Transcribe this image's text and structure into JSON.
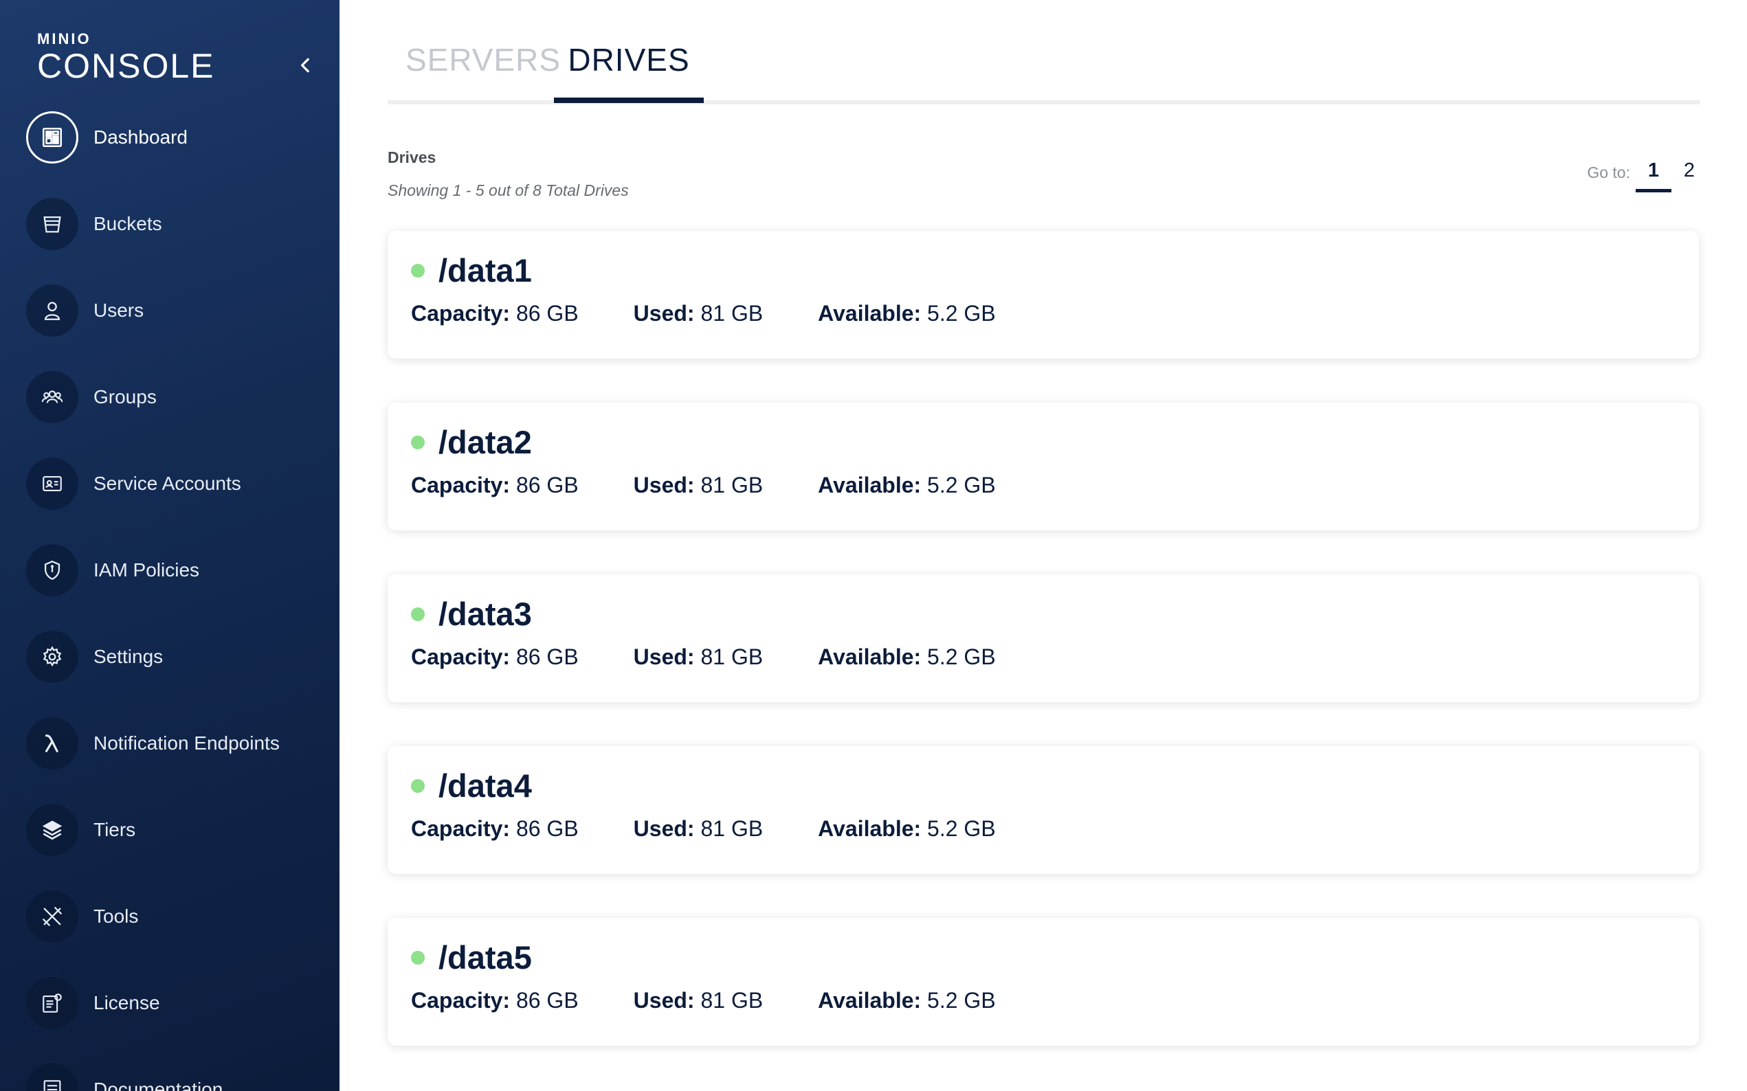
{
  "app": {
    "logo_top": "MINIO",
    "logo_main": "CONSOLE"
  },
  "sidebar": {
    "items": [
      {
        "label": "Dashboard",
        "icon": "dashboard-icon",
        "active": true
      },
      {
        "label": "Buckets",
        "icon": "bucket-icon"
      },
      {
        "label": "Users",
        "icon": "user-icon"
      },
      {
        "label": "Groups",
        "icon": "groups-icon"
      },
      {
        "label": "Service Accounts",
        "icon": "id-card-icon"
      },
      {
        "label": "IAM Policies",
        "icon": "shield-icon"
      },
      {
        "label": "Settings",
        "icon": "gear-icon"
      },
      {
        "label": "Notification Endpoints",
        "icon": "lambda-icon"
      },
      {
        "label": "Tiers",
        "icon": "layers-icon"
      },
      {
        "label": "Tools",
        "icon": "tools-icon"
      },
      {
        "label": "License",
        "icon": "license-icon"
      },
      {
        "label": "Documentation",
        "icon": "documentation-icon"
      }
    ]
  },
  "tabs": [
    {
      "label": "SERVERS",
      "active": false
    },
    {
      "label": "DRIVES",
      "active": true
    }
  ],
  "section": {
    "title": "Drives",
    "subtitle": "Showing 1 - 5 out of 8 Total Drives"
  },
  "pager": {
    "label": "Go to:",
    "pages": [
      "1",
      "2"
    ],
    "current": "1"
  },
  "labels": {
    "capacity": "Capacity:",
    "used": "Used:",
    "available": "Available:"
  },
  "drives": [
    {
      "name": "/data1",
      "capacity": "86 GB",
      "used": "81 GB",
      "available": "5.2 GB",
      "status": "online"
    },
    {
      "name": "/data2",
      "capacity": "86 GB",
      "used": "81 GB",
      "available": "5.2 GB",
      "status": "online"
    },
    {
      "name": "/data3",
      "capacity": "86 GB",
      "used": "81 GB",
      "available": "5.2 GB",
      "status": "online"
    },
    {
      "name": "/data4",
      "capacity": "86 GB",
      "used": "81 GB",
      "available": "5.2 GB",
      "status": "online"
    },
    {
      "name": "/data5",
      "capacity": "86 GB",
      "used": "81 GB",
      "available": "5.2 GB",
      "status": "online"
    }
  ],
  "colors": {
    "navy": "#0c1c3b",
    "online": "#8ee08a"
  }
}
